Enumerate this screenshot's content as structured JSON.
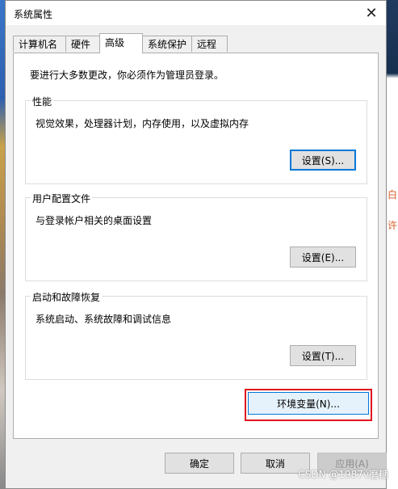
{
  "window": {
    "title": "系统属性"
  },
  "tabs": [
    {
      "label": "计算机名",
      "active": false
    },
    {
      "label": "硬件",
      "active": false
    },
    {
      "label": "高级",
      "active": true
    },
    {
      "label": "系统保护",
      "active": false
    },
    {
      "label": "远程",
      "active": false
    }
  ],
  "advanced": {
    "intro": "要进行大多数更改，你必须作为管理员登录。",
    "performance": {
      "title": "性能",
      "description": "视觉效果，处理器计划，内存使用，以及虚拟内存",
      "settings_label": "设置(S)..."
    },
    "user_profiles": {
      "title": "用户配置文件",
      "description": "与登录帐户相关的桌面设置",
      "settings_label": "设置(E)..."
    },
    "startup_recovery": {
      "title": "启动和故障恢复",
      "description": "系统启动、系统故障和调试信息",
      "settings_label": "设置(T)..."
    },
    "env_vars_label": "环境变量(N)..."
  },
  "footer": {
    "ok_label": "确定",
    "cancel_label": "取消",
    "apply_label": "应用(A)"
  },
  "watermark": "CSDN @1987v磨糖",
  "background_edge": {
    "char1": "白",
    "char2": "许"
  },
  "colors": {
    "highlight": "#e0141e",
    "focus": "#0078d7"
  }
}
